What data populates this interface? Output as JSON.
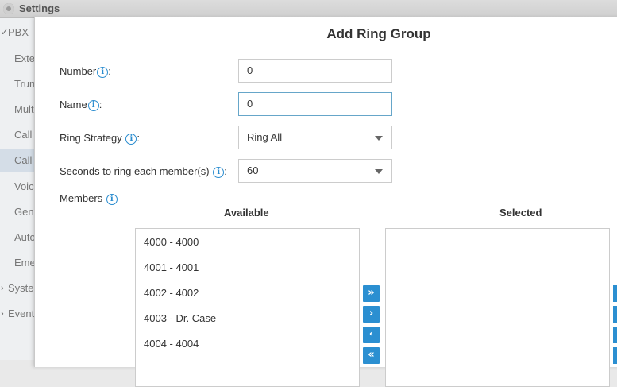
{
  "app": {
    "title": "Settings",
    "sidebar": [
      {
        "label": "PBX",
        "caret": "✓",
        "indent": "top"
      },
      {
        "label": "Extensions",
        "indent": "sub"
      },
      {
        "label": "Trunks",
        "indent": "sub"
      },
      {
        "label": "Multisite",
        "indent": "sub"
      },
      {
        "label": "Call Control",
        "indent": "sub"
      },
      {
        "label": "Call Features",
        "indent": "sub"
      },
      {
        "label": "Voicemail",
        "indent": "sub"
      },
      {
        "label": "General",
        "indent": "sub"
      },
      {
        "label": "Auto Provisioning",
        "indent": "sub"
      },
      {
        "label": "Emergency",
        "indent": "sub"
      },
      {
        "label": "System",
        "caret": "›",
        "indent": "top"
      },
      {
        "label": "Event Center",
        "caret": "›",
        "indent": "top"
      }
    ]
  },
  "dialog": {
    "title": "Add Ring Group",
    "fields": {
      "number": {
        "label": "Number",
        "suffix": ":",
        "value": "0"
      },
      "name": {
        "label": "Name",
        "suffix": ":",
        "value": "0"
      },
      "ring_strategy": {
        "label": "Ring Strategy",
        "suffix": ":",
        "value": "Ring All"
      },
      "seconds": {
        "label": "Seconds to ring each member(s)",
        "suffix": ":",
        "value": "60"
      }
    },
    "members": {
      "label": "Members",
      "available_label": "Available",
      "selected_label": "Selected",
      "available": [
        "4000 - 4000",
        "4001 - 4001",
        "4002 - 4002",
        "4003 - Dr. Case",
        "4004 - 4004"
      ],
      "buttons": {
        "add_all": "»",
        "add": "›",
        "remove": "‹",
        "remove_all": "«"
      }
    },
    "info_glyph": "i"
  }
}
